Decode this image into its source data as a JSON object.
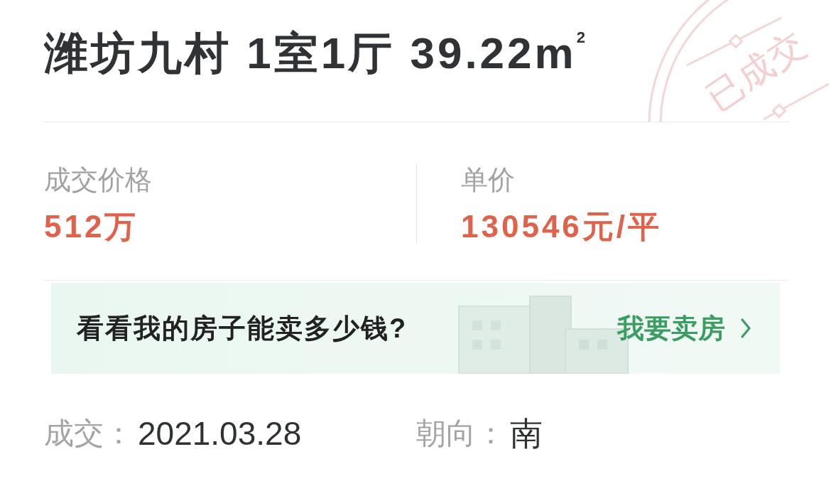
{
  "title": "潍坊九村 1室1厅 39.22m$^{2}$",
  "stamp": {
    "text": "已成交"
  },
  "prices": [
    {
      "label": "成交价格",
      "value": "512万"
    },
    {
      "label": "单价",
      "value": "130546元/平"
    }
  ],
  "banner": {
    "text": "看看我的房子能卖多少钱?",
    "link": "我要卖房"
  },
  "details": [
    {
      "label": "成交：",
      "value": "2021.03.28"
    },
    {
      "label": "朝向：",
      "value": "南"
    }
  ]
}
